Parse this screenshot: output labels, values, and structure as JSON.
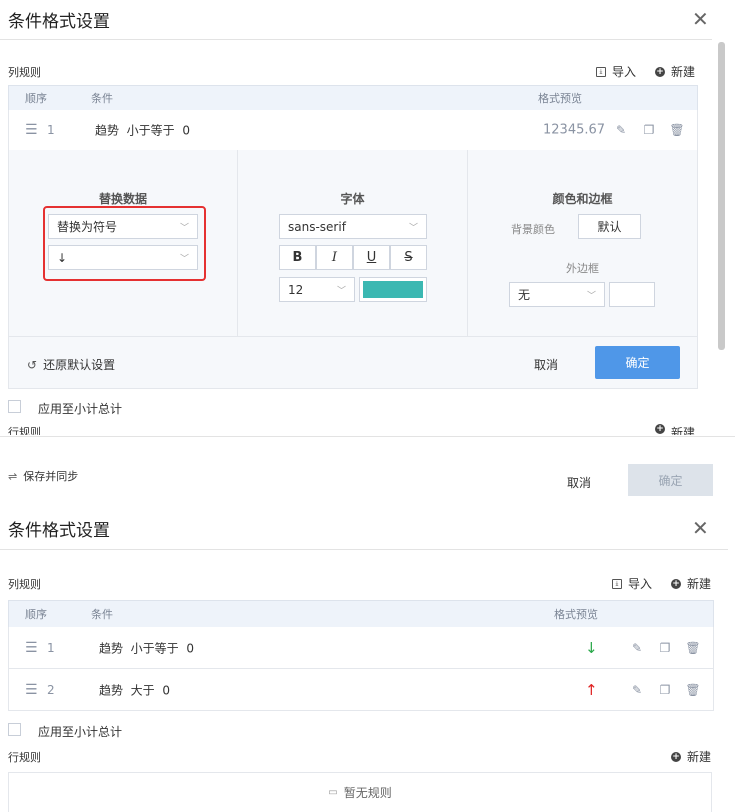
{
  "top": {
    "title": "条件格式设置",
    "column_rules_label": "列规则",
    "import_label": "导入",
    "new_label": "新建",
    "columns": {
      "order": "顺序",
      "condition": "条件",
      "preview": "格式预览"
    },
    "rule": {
      "index": "1",
      "field": "趋势",
      "op": "小于等于",
      "value": "0",
      "preview": "12345.67"
    },
    "editor": {
      "replace_title": "替换数据",
      "replace_type": "替换为符号",
      "replace_symbol": "↓",
      "font_title": "字体",
      "font_family": "sans-serif",
      "bold": "B",
      "italic": "I",
      "underline": "U",
      "strike": "S",
      "font_size": "12",
      "font_color": "#3bb8b2",
      "color_title": "颜色和边框",
      "bg_label": "背景颜色",
      "bg_value": "默认",
      "border_label": "外边框",
      "border_value": "无"
    },
    "restore_label": "还原默认设置",
    "cancel_label": "取消",
    "ok_label": "确定",
    "subtotal_label": "应用至小计总计",
    "row_rules_label": "行规则",
    "row_new_label": "新建",
    "save_sync_label": "保存并同步",
    "footer_cancel": "取消",
    "footer_ok": "确定"
  },
  "bottom": {
    "title": "条件格式设置",
    "column_rules_label": "列规则",
    "import_label": "导入",
    "new_label": "新建",
    "columns": {
      "order": "顺序",
      "condition": "条件",
      "preview": "格式预览"
    },
    "rules": [
      {
        "index": "1",
        "field": "趋势",
        "op": "小于等于",
        "value": "0",
        "preview": "↓",
        "color": "#2aa84a"
      },
      {
        "index": "2",
        "field": "趋势",
        "op": "大于",
        "value": "0",
        "preview": "↑",
        "color": "#e02424"
      }
    ],
    "subtotal_label": "应用至小计总计",
    "row_rules_label": "行规则",
    "row_new_label": "新建",
    "empty_label": "暂无规则"
  }
}
